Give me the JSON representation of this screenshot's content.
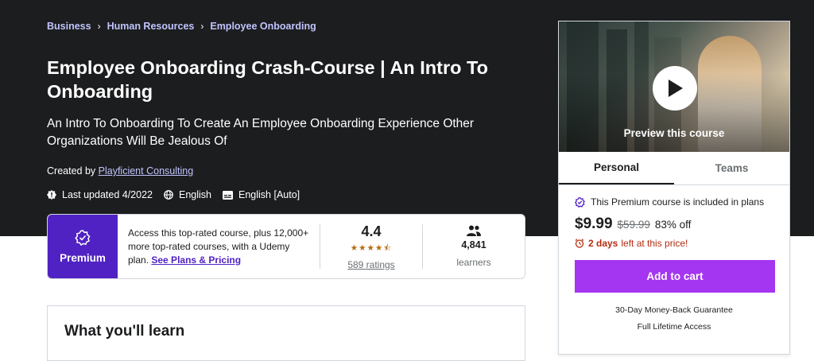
{
  "breadcrumb": [
    "Business",
    "Human Resources",
    "Employee Onboarding"
  ],
  "course": {
    "title": "Employee Onboarding Crash-Course | An Intro To Onboarding",
    "subtitle": "An Intro To Onboarding To Create An Employee Onboarding Experience Other Organizations Will Be Jealous Of",
    "created_by_label": "Created by",
    "instructor": "Playficient Consulting",
    "last_updated": "Last updated 4/2022",
    "language": "English",
    "captions": "English [Auto]"
  },
  "premium": {
    "badge_label": "Premium",
    "text": "Access this top-rated course, plus 12,000+ more top-rated courses, with a Udemy plan.",
    "link": "See Plans & Pricing",
    "rating": "4.4",
    "rating_value": 4.4,
    "ratings_count": "589 ratings",
    "learners": "4,841",
    "learners_label": "learners"
  },
  "learn": {
    "heading": "What you'll learn"
  },
  "sidebar": {
    "preview_label": "Preview this course",
    "tabs": [
      "Personal",
      "Teams"
    ],
    "included_text": "This Premium course is included in plans",
    "price": "$9.99",
    "original_price": "$59.99",
    "discount": "83% off",
    "timer_bold": "2 days",
    "timer_text": "left at this price!",
    "cart_button": "Add to cart",
    "guarantee": "30-Day Money-Back Guarantee",
    "lifetime": "Full Lifetime Access"
  },
  "colors": {
    "hero_bg": "#1c1d1f",
    "link_light": "#c0c4fc",
    "premium_purple": "#5022c3",
    "cart_purple": "#a435f0",
    "star": "#b4690e",
    "urgent": "#b32d0f"
  }
}
